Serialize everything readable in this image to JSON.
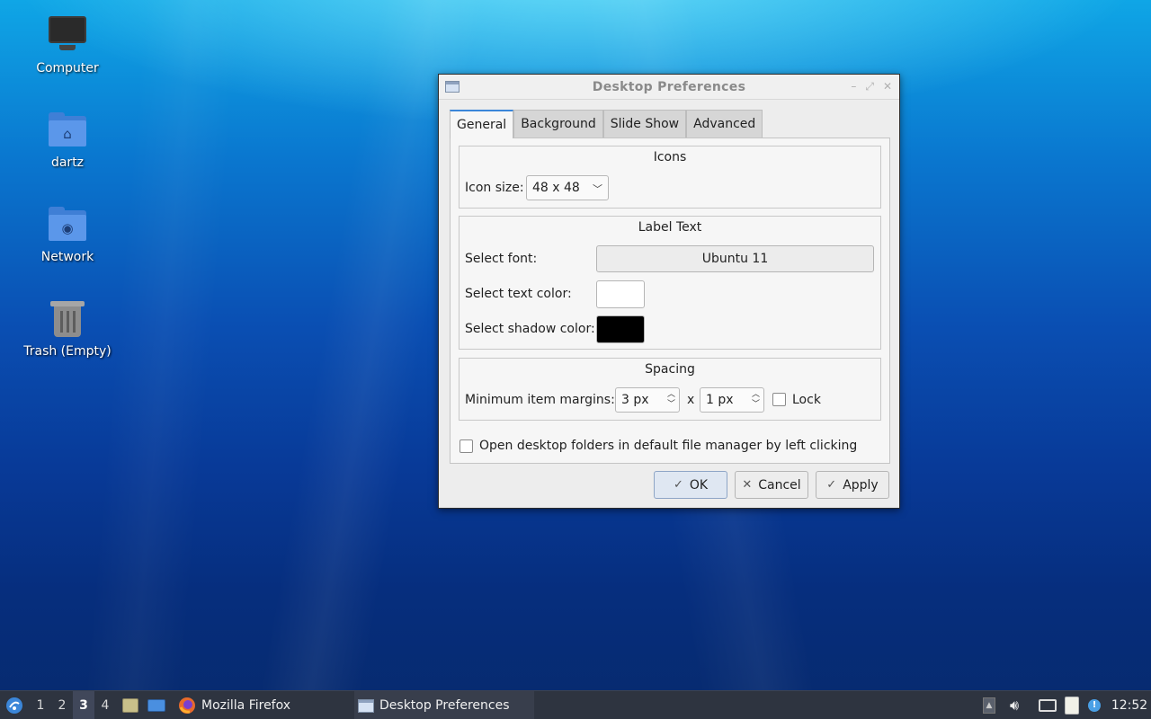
{
  "desktop": {
    "icons": [
      {
        "label": "Computer",
        "icon": "computer-icon"
      },
      {
        "label": "dartz",
        "icon": "home-folder-icon"
      },
      {
        "label": "Network",
        "icon": "network-folder-icon"
      },
      {
        "label": "Trash (Empty)",
        "icon": "trash-icon"
      }
    ]
  },
  "dialog": {
    "title": "Desktop Preferences",
    "tabs": [
      {
        "label": "General",
        "active": true
      },
      {
        "label": "Background",
        "active": false
      },
      {
        "label": "Slide Show",
        "active": false
      },
      {
        "label": "Advanced",
        "active": false
      }
    ],
    "icons_section": {
      "title": "Icons",
      "icon_size_label": "Icon size:",
      "icon_size_value": "48 x 48"
    },
    "label_section": {
      "title": "Label Text",
      "font_label": "Select font:",
      "font_value": "Ubuntu 11",
      "text_color_label": "Select text color:",
      "text_color": "#ffffff",
      "shadow_color_label": "Select shadow color:",
      "shadow_color": "#000000"
    },
    "spacing_section": {
      "title": "Spacing",
      "margins_label": "Minimum item margins:",
      "margin_x": "3 px",
      "separator": "x",
      "margin_y": "1 px",
      "lock_label": "Lock",
      "lock_checked": false
    },
    "open_folders_label": "Open desktop folders in default file manager by left clicking",
    "open_folders_checked": false,
    "buttons": {
      "ok": "OK",
      "cancel": "Cancel",
      "apply": "Apply"
    }
  },
  "taskbar": {
    "workspaces": [
      "1",
      "2",
      "3",
      "4"
    ],
    "active_workspace": "3",
    "tasks": [
      {
        "label": "Mozilla Firefox",
        "icon": "firefox-icon"
      },
      {
        "label": "Desktop Preferences",
        "icon": "window-icon"
      }
    ],
    "clock": "12:52"
  },
  "colors": {
    "accent": "#3b86d9",
    "taskbar_bg": "#2e3440"
  }
}
